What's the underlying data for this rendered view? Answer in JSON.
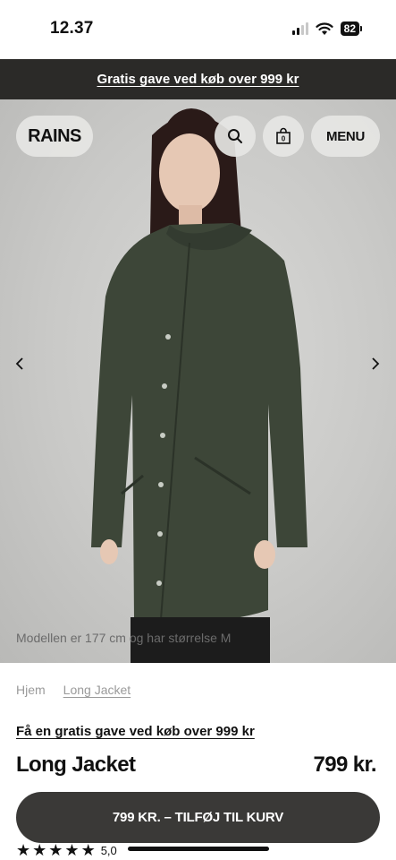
{
  "status": {
    "time": "12.37",
    "battery": "82"
  },
  "promo": {
    "banner_text": "Gratis gave ved køb over 999 kr"
  },
  "header": {
    "logo": "RAINS",
    "menu_label": "MENU",
    "search_icon": "search-icon",
    "bag_icon": "shopping-bag-icon",
    "bag_count": "0"
  },
  "hero": {
    "caption": "Modellen er 177 cm og har størrelse M",
    "prev_icon": "chevron-left-icon",
    "next_icon": "chevron-right-icon"
  },
  "breadcrumb": {
    "home": "Hjem",
    "current": "Long Jacket"
  },
  "product": {
    "gift_link": "Få en gratis gave ved køb over 999 kr",
    "name": "Long Jacket",
    "price": "799 kr.",
    "cart_button": "799 KR. – TILFØJ TIL KURV",
    "rating_value": "5,0",
    "rating_stars": 5
  },
  "colors": {
    "banner_bg": "#2b2a28",
    "button_bg": "#3a3937",
    "jacket": "#3d4638"
  }
}
